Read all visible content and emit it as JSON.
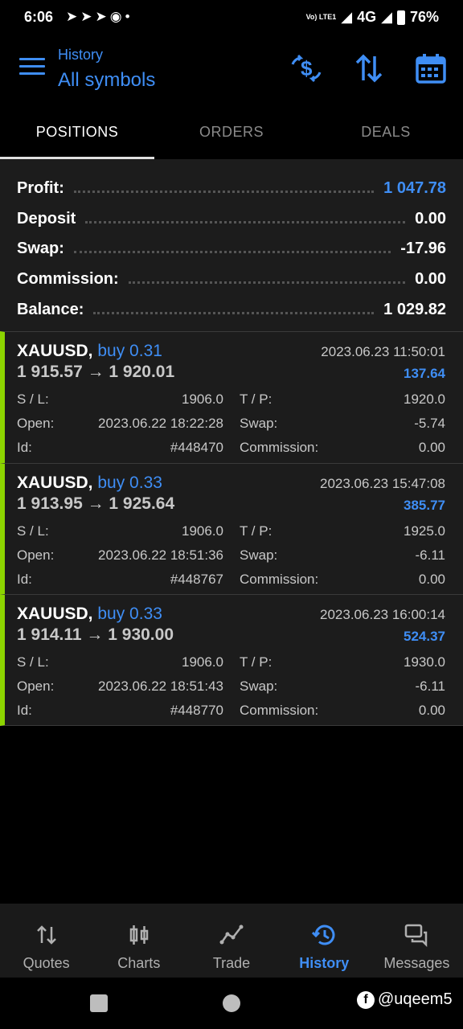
{
  "status_bar": {
    "time": "6:06",
    "notification_icons": [
      "telegram-icon",
      "telegram-icon",
      "telegram-icon",
      "music-icon",
      "dot-icon"
    ],
    "volte": "Vo) LTE1",
    "network": "4G",
    "battery": "76%"
  },
  "toolbar": {
    "subtitle": "History",
    "title": "All symbols",
    "icons": [
      "currency-exchange-icon",
      "sort-icon",
      "calendar-icon"
    ],
    "accent_color": "#3f8ef5"
  },
  "tabs": [
    {
      "label": "POSITIONS",
      "active": true
    },
    {
      "label": "ORDERS",
      "active": false
    },
    {
      "label": "DEALS",
      "active": false
    }
  ],
  "summary": [
    {
      "label": "Profit:",
      "value": "1 047.78",
      "highlight": true
    },
    {
      "label": "Deposit",
      "value": "0.00",
      "highlight": false
    },
    {
      "label": "Swap:",
      "value": "-17.96",
      "highlight": false
    },
    {
      "label": "Commission:",
      "value": "0.00",
      "highlight": false
    },
    {
      "label": "Balance:",
      "value": "1 029.82",
      "highlight": false
    }
  ],
  "positions": [
    {
      "symbol": "XAUUSD,",
      "side": "buy 0.31",
      "close_time": "2023.06.23 11:50:01",
      "prices": "1 915.57 → 1 920.01",
      "profit": "137.64",
      "sl_label": "S / L:",
      "sl": "1906.0",
      "tp_label": "T / P:",
      "tp": "1920.0",
      "open_label": "Open:",
      "open": "2023.06.22 18:22:28",
      "swap_label": "Swap:",
      "swap": "-5.74",
      "id_label": "Id:",
      "id": "#448470",
      "commission_label": "Commission:",
      "commission": "0.00"
    },
    {
      "symbol": "XAUUSD,",
      "side": "buy 0.33",
      "close_time": "2023.06.23 15:47:08",
      "prices": "1 913.95 → 1 925.64",
      "profit": "385.77",
      "sl_label": "S / L:",
      "sl": "1906.0",
      "tp_label": "T / P:",
      "tp": "1925.0",
      "open_label": "Open:",
      "open": "2023.06.22 18:51:36",
      "swap_label": "Swap:",
      "swap": "-6.11",
      "id_label": "Id:",
      "id": "#448767",
      "commission_label": "Commission:",
      "commission": "0.00"
    },
    {
      "symbol": "XAUUSD,",
      "side": "buy 0.33",
      "close_time": "2023.06.23 16:00:14",
      "prices": "1 914.11 → 1 930.00",
      "profit": "524.37",
      "sl_label": "S / L:",
      "sl": "1906.0",
      "tp_label": "T / P:",
      "tp": "1930.0",
      "open_label": "Open:",
      "open": "2023.06.22 18:51:43",
      "swap_label": "Swap:",
      "swap": "-6.11",
      "id_label": "Id:",
      "id": "#448770",
      "commission_label": "Commission:",
      "commission": "0.00"
    }
  ],
  "bottom_nav": [
    {
      "label": "Quotes",
      "icon": "quotes-arrows-icon",
      "active": false
    },
    {
      "label": "Charts",
      "icon": "candlestick-icon",
      "active": false
    },
    {
      "label": "Trade",
      "icon": "trend-line-icon",
      "active": false
    },
    {
      "label": "History",
      "icon": "history-clock-icon",
      "active": true
    },
    {
      "label": "Messages",
      "icon": "chat-bubbles-icon",
      "active": false
    }
  ],
  "watermark": "@uqeem5",
  "colors": {
    "profit_bar": "#8cd400",
    "accent": "#3f8ef5",
    "panel": "#1c1c1c"
  }
}
